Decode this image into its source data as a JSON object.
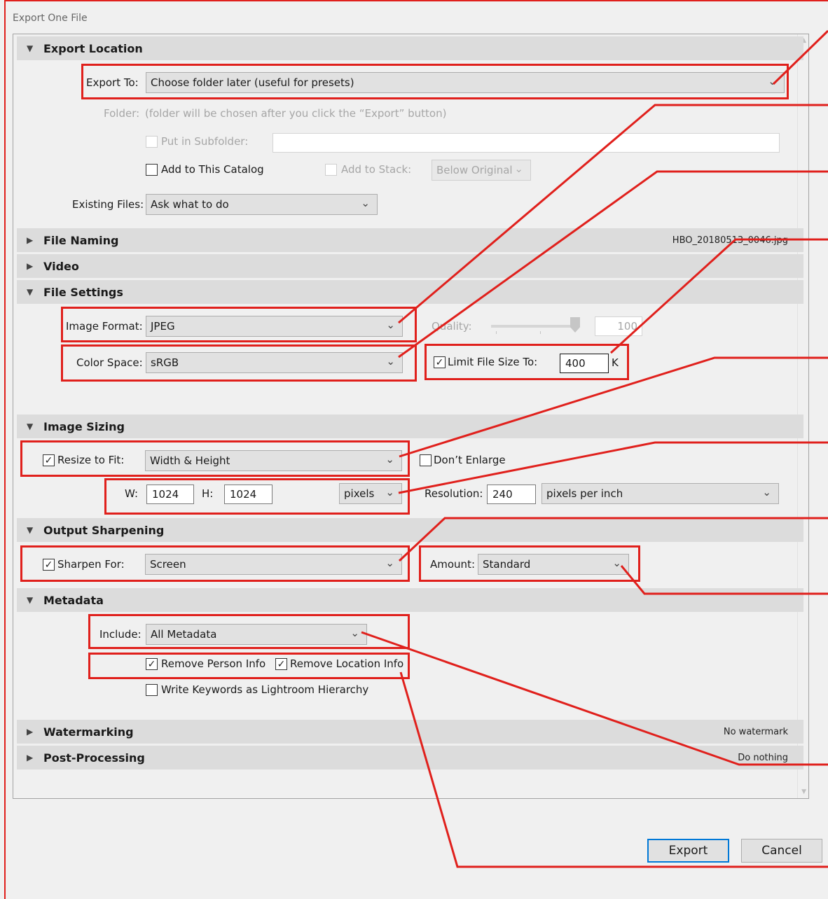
{
  "dialog": {
    "title": "Export One File"
  },
  "sections": {
    "export_location": {
      "title": "Export Location",
      "expanded": true
    },
    "file_naming": {
      "title": "File Naming",
      "info": "HBO_20180513_0046.jpg",
      "expanded": false
    },
    "video": {
      "title": "Video",
      "expanded": false
    },
    "file_settings": {
      "title": "File Settings",
      "expanded": true
    },
    "image_sizing": {
      "title": "Image Sizing",
      "expanded": true
    },
    "output_sharpening": {
      "title": "Output Sharpening",
      "expanded": true
    },
    "metadata": {
      "title": "Metadata",
      "expanded": true
    },
    "watermarking": {
      "title": "Watermarking",
      "info": "No watermark",
      "expanded": false
    },
    "post_processing": {
      "title": "Post-Processing",
      "info": "Do nothing",
      "expanded": false
    }
  },
  "export_location": {
    "export_to_label": "Export To:",
    "export_to_value": "Choose folder later (useful for presets)",
    "folder_label": "Folder:",
    "folder_note": "(folder will be chosen after you click the “Export” button)",
    "subfolder_label": "Put in Subfolder:",
    "subfolder_checked": false,
    "subfolder_value": "",
    "add_catalog_label": "Add to This Catalog",
    "add_catalog_checked": false,
    "add_stack_label": "Add to Stack:",
    "add_stack_checked": false,
    "stack_position": "Below Original",
    "existing_files_label": "Existing Files:",
    "existing_files_value": "Ask what to do"
  },
  "file_settings": {
    "image_format_label": "Image Format:",
    "image_format_value": "JPEG",
    "quality_label": "Quality:",
    "quality_value": "100",
    "color_space_label": "Color Space:",
    "color_space_value": "sRGB",
    "limit_size_label": "Limit File Size To:",
    "limit_size_checked": true,
    "limit_size_value": "400",
    "limit_size_unit": "K"
  },
  "image_sizing": {
    "resize_label": "Resize to Fit:",
    "resize_checked": true,
    "resize_value": "Width & Height",
    "dont_enlarge_label": "Don’t Enlarge",
    "dont_enlarge_checked": false,
    "w_label": "W:",
    "w_value": "1024",
    "h_label": "H:",
    "h_value": "1024",
    "units_value": "pixels",
    "resolution_label": "Resolution:",
    "resolution_value": "240",
    "resolution_units": "pixels per inch"
  },
  "output_sharpening": {
    "sharpen_label": "Sharpen For:",
    "sharpen_checked": true,
    "sharpen_value": "Screen",
    "amount_label": "Amount:",
    "amount_value": "Standard"
  },
  "metadata": {
    "include_label": "Include:",
    "include_value": "All Metadata",
    "remove_person_label": "Remove Person Info",
    "remove_person_checked": true,
    "remove_location_label": "Remove Location Info",
    "remove_location_checked": true,
    "keywords_label": "Write Keywords as Lightroom Hierarchy",
    "keywords_checked": false
  },
  "buttons": {
    "export": "Export",
    "cancel": "Cancel"
  },
  "icons": {
    "expanded": "triangle-down-icon",
    "collapsed": "triangle-right-icon",
    "dropdown": "chevron-down-icon",
    "checked": "checkmark-icon"
  },
  "colors": {
    "annotation": "#e0201c",
    "section_header": "#dcdcdc",
    "primary_button_border": "#0078d7"
  }
}
